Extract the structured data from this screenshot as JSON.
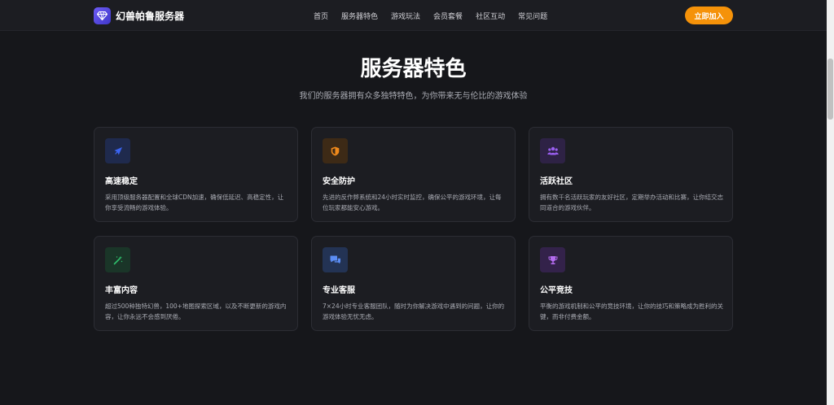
{
  "header": {
    "logo_text": "幻兽帕鲁服务器",
    "nav": [
      "首页",
      "服务器特色",
      "游戏玩法",
      "会员套餐",
      "社区互动",
      "常见问题"
    ],
    "join_label": "立即加入"
  },
  "features": {
    "title": "服务器特色",
    "subtitle": "我们的服务器拥有众多独特特色，为你带来无与伦比的游戏体验",
    "cards": [
      {
        "title": "高速稳定",
        "desc": "采用顶级服务器配置和全球CDN加速，确保低延迟、高稳定性，让你享受流畅的游戏体验。",
        "icon": "rocket-icon",
        "color": "#3a64f0"
      },
      {
        "title": "安全防护",
        "desc": "先进的反作弊系统和24小时实时监控，确保公平的游戏环境，让每位玩家都能安心游戏。",
        "icon": "shield-icon",
        "color": "#f08a1c"
      },
      {
        "title": "活跃社区",
        "desc": "拥有数千名活跃玩家的友好社区，定期举办活动和比赛，让你结交志同道合的游戏伙伴。",
        "icon": "users-icon",
        "color": "#9a5ff0"
      },
      {
        "title": "丰富内容",
        "desc": "超过500种独特幻兽，100+地图探索区域，以及不断更新的游戏内容，让你永远不会感到厌倦。",
        "icon": "magic-wand-icon",
        "color": "#2fbf6c"
      },
      {
        "title": "专业客服",
        "desc": "7×24小时专业客服团队，随时为你解决游戏中遇到的问题，让你的游戏体验无忧无虑。",
        "icon": "chat-bubbles-icon",
        "color": "#5b8df5"
      },
      {
        "title": "公平竞技",
        "desc": "平衡的游戏机制和公平的竞技环境，让你的技巧和策略成为胜利的关键，而非付费金额。",
        "icon": "trophy-icon",
        "color": "#b46cf0"
      }
    ]
  }
}
